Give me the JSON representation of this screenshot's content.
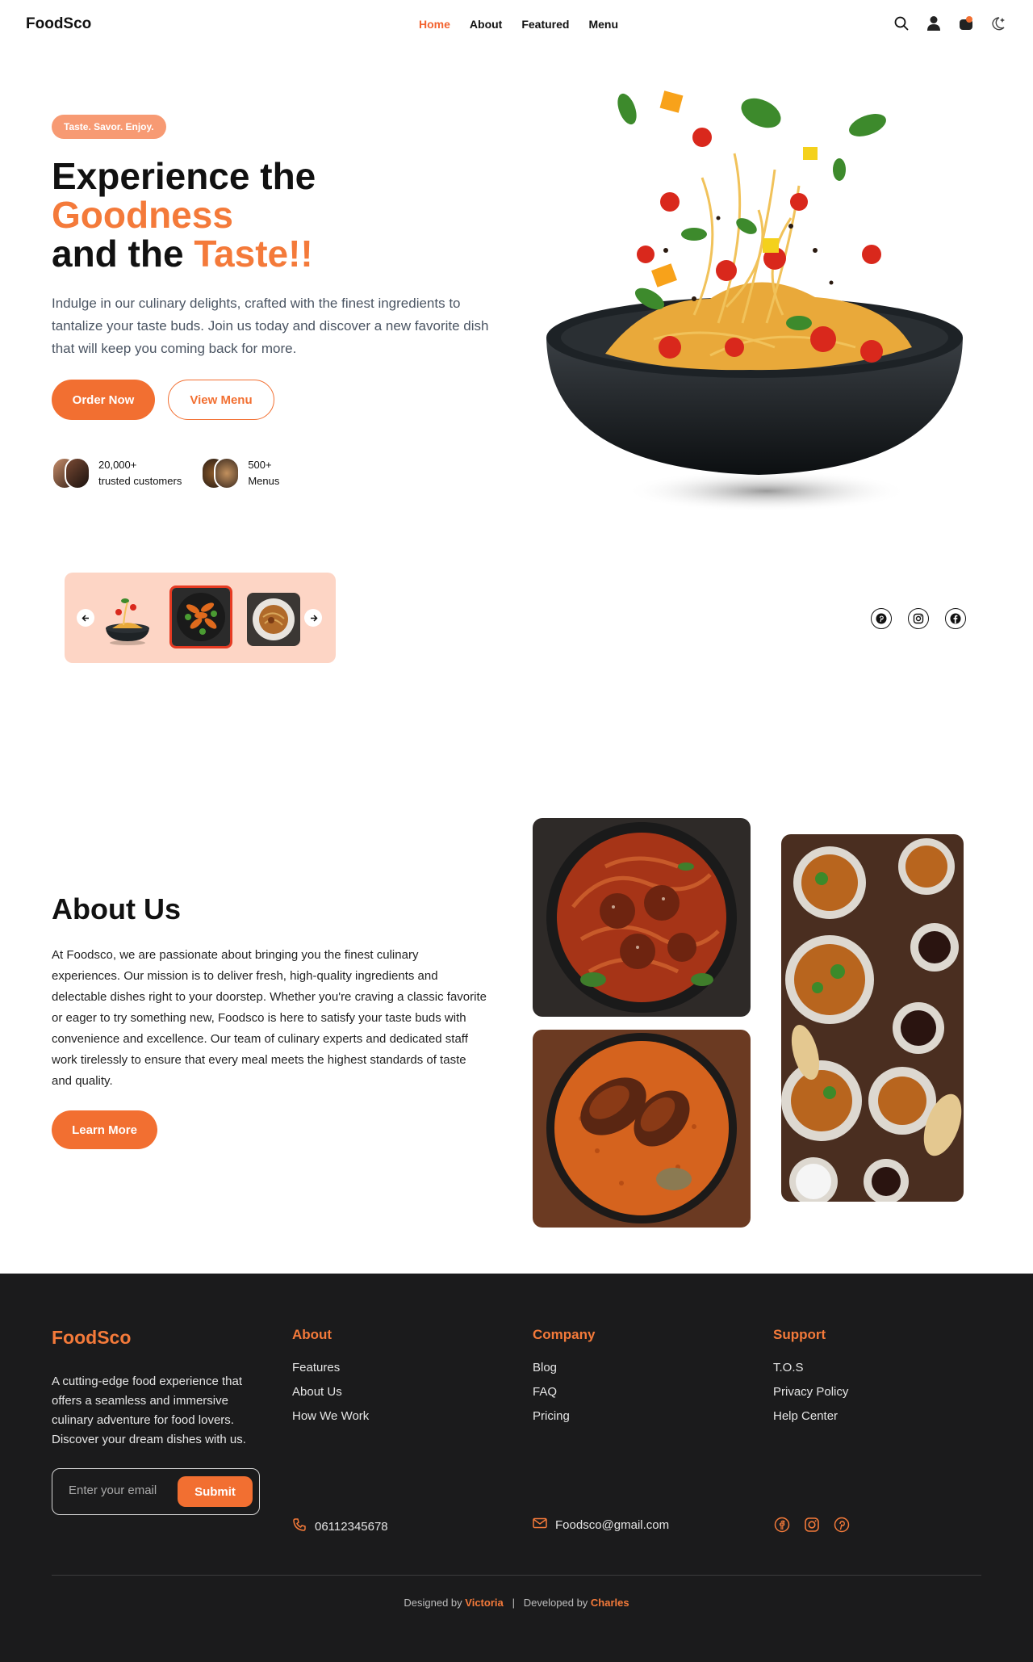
{
  "nav": {
    "logo": "FoodSco",
    "links": [
      "Home",
      "About",
      "Featured",
      "Menu"
    ],
    "icons": [
      "search-icon",
      "user-icon",
      "cart-icon",
      "theme-toggle-icon"
    ]
  },
  "hero": {
    "tag": "Taste. Savor. Enjoy.",
    "title_line1": "Experience the",
    "title_line2": "Goodness",
    "title_line3_a": "and the ",
    "title_line3_b": "Taste!!",
    "description": "Indulge in our culinary delights, crafted with the finest ingredients to tantalize your taste buds. Join us today and discover a new favorite dish that will keep you coming back for more.",
    "order_button": "Order Now",
    "menu_button": "View Menu",
    "stats": [
      {
        "value": "20,000+",
        "label": "trusted customers"
      },
      {
        "value": "500+",
        "label": "Menus"
      }
    ]
  },
  "about": {
    "title": "About Us",
    "text": "At Foodsco, we are passionate about bringing you the finest culinary experiences. Our mission is to deliver fresh, high-quality ingredients and delectable dishes right to your doorstep. Whether you're craving a classic favorite or eager to try something new, Foodsco is here to satisfy your taste buds with convenience and excellence. Our team of culinary experts and dedicated staff work tirelessly to ensure that every meal meets the highest standards of taste and quality.",
    "button": "Learn More"
  },
  "footer": {
    "logo": "FoodSco",
    "description": "A cutting-edge food experience that offers a seamless and immersive culinary adventure for food lovers. Discover your dream dishes with us.",
    "email_placeholder": "Enter your email",
    "submit": "Submit",
    "columns": [
      {
        "title": "About",
        "items": [
          "Features",
          "About Us",
          "How We Work"
        ]
      },
      {
        "title": "Company",
        "items": [
          "Blog",
          "FAQ",
          "Pricing"
        ]
      },
      {
        "title": "Support",
        "items": [
          "T.O.S",
          "Privacy Policy",
          "Help Center"
        ]
      }
    ],
    "phone": "06112345678",
    "email": "Foodsco@gmail.com",
    "credit_designed": "Designed by ",
    "designer": "Victoria",
    "separator": "|",
    "credit_developed": "Developed by ",
    "developer": "Charles"
  },
  "colors": {
    "accent": "#f26f31",
    "accent_light": "#f47a3a",
    "pill": "#f79a73",
    "carousel_bg": "#fdd5c5",
    "footer_bg": "#1b1b1c"
  }
}
